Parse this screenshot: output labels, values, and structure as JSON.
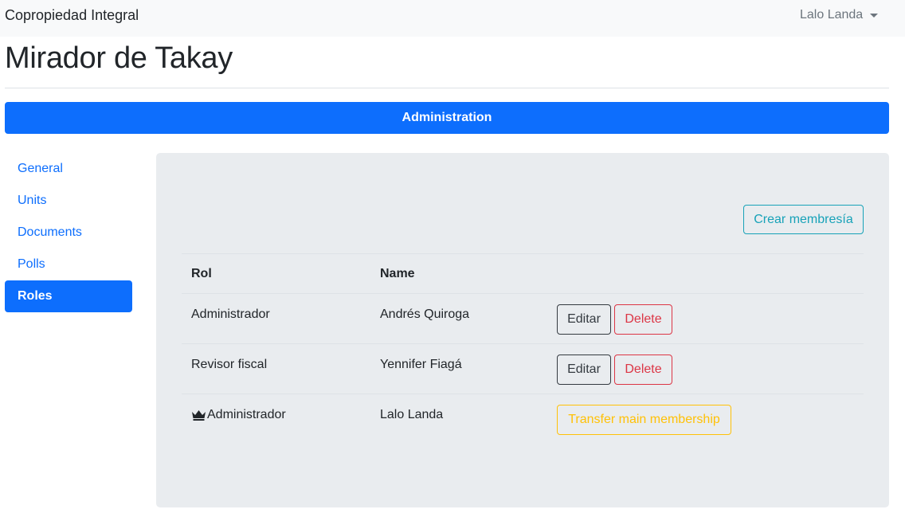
{
  "navbar": {
    "brand": "Copropiedad Integral",
    "user_name": "Lalo Landa"
  },
  "page": {
    "title": "Mirador de Takay",
    "section_button": "Administration"
  },
  "sidebar": {
    "items": [
      {
        "label": "General",
        "active": false
      },
      {
        "label": "Units",
        "active": false
      },
      {
        "label": "Documents",
        "active": false
      },
      {
        "label": "Polls",
        "active": false
      },
      {
        "label": "Roles",
        "active": true
      }
    ]
  },
  "panel": {
    "create_button": "Crear membresía",
    "table": {
      "headers": {
        "rol": "Rol",
        "name": "Name"
      },
      "rows": [
        {
          "rol": "Administrador",
          "name": "Andrés Quiroga",
          "edit_label": "Editar",
          "delete_label": "Delete"
        },
        {
          "rol": "Revisor fiscal",
          "name": "Yennifer Fiagá",
          "edit_label": "Editar",
          "delete_label": "Delete"
        },
        {
          "rol": "Administrador",
          "name": "Lalo Landa",
          "icon": "crown-icon",
          "transfer_label": "Transfer main membership"
        }
      ]
    }
  },
  "colors": {
    "primary": "#0d6efd",
    "info": "#17a2b8",
    "danger": "#dc3545",
    "warning": "#ffc107",
    "dark": "#343a40",
    "panel_bg": "#e9ecef"
  }
}
